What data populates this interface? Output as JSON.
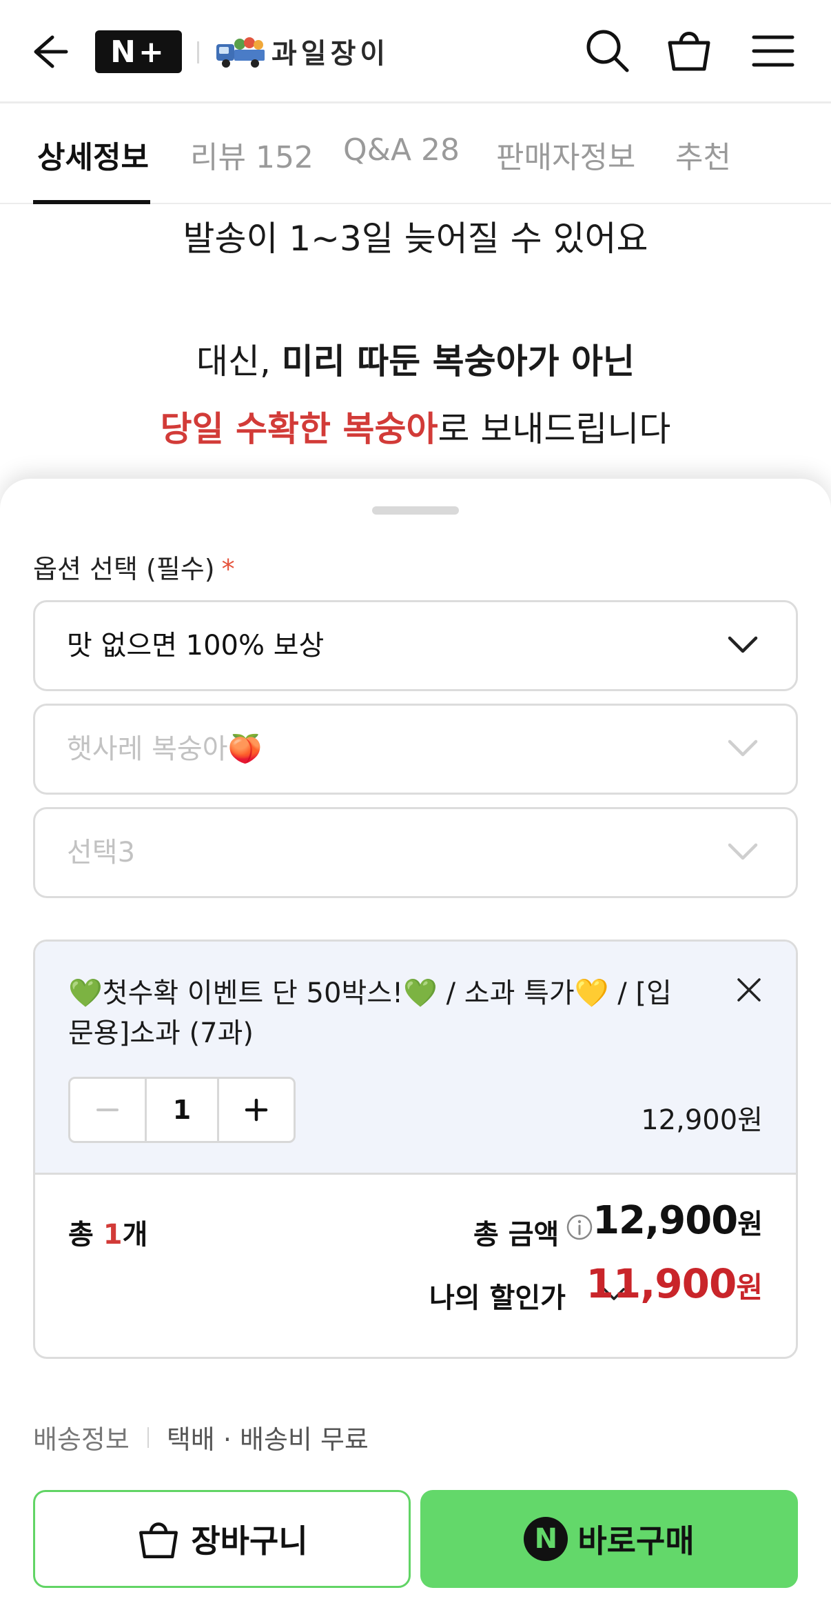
{
  "header": {
    "brand_badge": "N+",
    "store_name": "과일장이",
    "icons": [
      "arrow-left-icon",
      "search-icon",
      "shopping-bag-icon",
      "hamburger-menu-icon"
    ]
  },
  "tabs": [
    {
      "label": "상세정보",
      "active": true
    },
    {
      "label": "리뷰 152",
      "active": false
    },
    {
      "label": "Q&A 28",
      "active": false
    },
    {
      "label": "판매자정보",
      "active": false
    },
    {
      "label": "추천",
      "active": false
    }
  ],
  "detail": {
    "line1": "발송이 1~3일 늦어질 수 있어요",
    "line2_prefix": "대신, ",
    "line2_bold": "미리 따둔 복숭아가 아닌",
    "line3_red": "당일 수확한 복숭아",
    "line3_rest": "로 보내드립니다"
  },
  "options": {
    "title": "옵션 선택 (필수)",
    "required_mark": "*",
    "select1": "맛 없으면 100% 보상",
    "select2": "햇사레 복숭아🍑",
    "select3": "선택3"
  },
  "selected_item": {
    "name": "💚첫수확 이벤트 단 50박스!💚 / 소과 특가💛 / [입문용]소과 (7과)",
    "quantity": "1",
    "price": "12,900원"
  },
  "totals": {
    "count_prefix": "총 ",
    "count_num": "1",
    "count_suffix": "개",
    "total_label": "총 금액",
    "total_amount": "12,900",
    "total_unit": "원",
    "discount_label": "나의 할인가",
    "discount_amount": "11,900",
    "discount_unit": "원"
  },
  "shipping": {
    "label": "배송정보",
    "value": "택배 · 배송비 무료"
  },
  "actions": {
    "cart_label": "장바구니",
    "buy_label": "바로구매",
    "npay_letter": "N"
  },
  "colors": {
    "accent_red": "#d23b38",
    "discount_red": "#c9252a",
    "buy_green": "#63d86a",
    "selected_bg": "#f1f4fb"
  }
}
